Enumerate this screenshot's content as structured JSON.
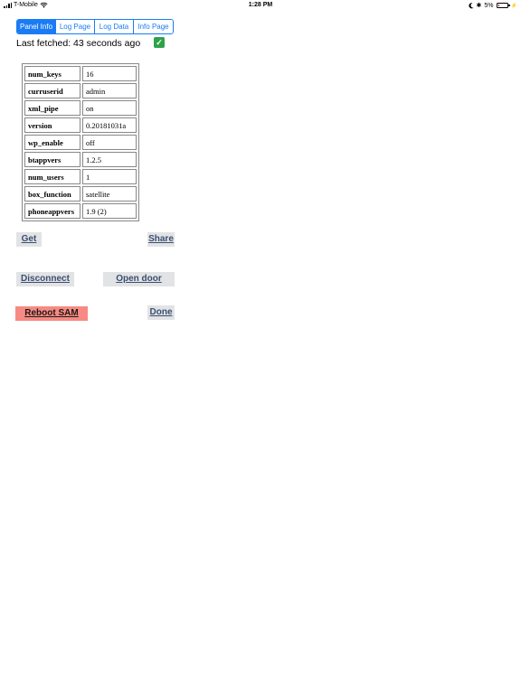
{
  "status_bar": {
    "carrier": "T-Mobile",
    "time": "1:28 PM",
    "battery_percent": "5%",
    "battery_level": 0.05,
    "battery_color": "#dd0000"
  },
  "tabs": [
    {
      "label": "Panel Info",
      "active": true
    },
    {
      "label": "Log Page",
      "active": false
    },
    {
      "label": "Log Data",
      "active": false
    },
    {
      "label": "Info Page",
      "active": false
    }
  ],
  "fetch_status": {
    "text": "Last fetched: 43 seconds ago",
    "icon": "check-icon",
    "icon_color": "#2ea24a"
  },
  "panel_table": {
    "rows": [
      {
        "key": "num_keys",
        "value": "16"
      },
      {
        "key": "curruserid",
        "value": "admin"
      },
      {
        "key": "xml_pipe",
        "value": "on"
      },
      {
        "key": "version",
        "value": "0.20181031a"
      },
      {
        "key": "wp_enable",
        "value": "off"
      },
      {
        "key": "btappvers",
        "value": "1.2.5"
      },
      {
        "key": "num_users",
        "value": "1"
      },
      {
        "key": "box_function",
        "value": "satellite"
      },
      {
        "key": "phoneappvers",
        "value": "1.9 (2)"
      }
    ]
  },
  "buttons": {
    "get": "Get",
    "share": "Share",
    "disconnect": "Disconnect",
    "open_door": "Open door",
    "reboot": "Reboot SAM",
    "done": "Done"
  },
  "colors": {
    "accent": "#1a7cf5",
    "button_bg": "#e2e3e5",
    "button_text": "#3a4e72",
    "danger_bg": "#f78a82"
  }
}
